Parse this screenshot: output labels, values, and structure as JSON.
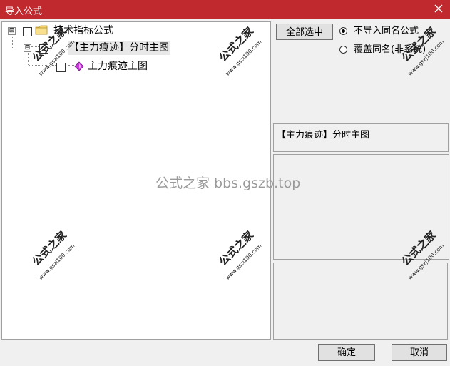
{
  "window": {
    "title": "导入公式",
    "close_icon": "close-icon"
  },
  "tree": {
    "root": {
      "label": "技术指标公式",
      "expander": "⊟",
      "icon": "folder-icon"
    },
    "group": {
      "label": "【主力痕迹】分时主图",
      "expander": "⊟"
    },
    "leaf": {
      "label": "主力痕迹主图",
      "icon": "formula-diamond-icon"
    }
  },
  "controls": {
    "select_all_label": "全部选中",
    "radio_skip_label": "不导入同名公式",
    "radio_overwrite_label": "覆盖同名(非系统)"
  },
  "info": {
    "selected_formula": "【主力痕迹】分时主图"
  },
  "footer": {
    "ok_label": "确定",
    "cancel_label": "取消"
  },
  "watermark": {
    "center_text": "公式之家 bbs.gszb.top",
    "stamp_text": "公式之家",
    "stamp_url": "www.gszj100.com"
  },
  "colors": {
    "title_bar": "#c0292d",
    "window_bg": "#f0f0f0",
    "tree_bg": "#ffffff",
    "watermark": "#9a9a9a"
  }
}
